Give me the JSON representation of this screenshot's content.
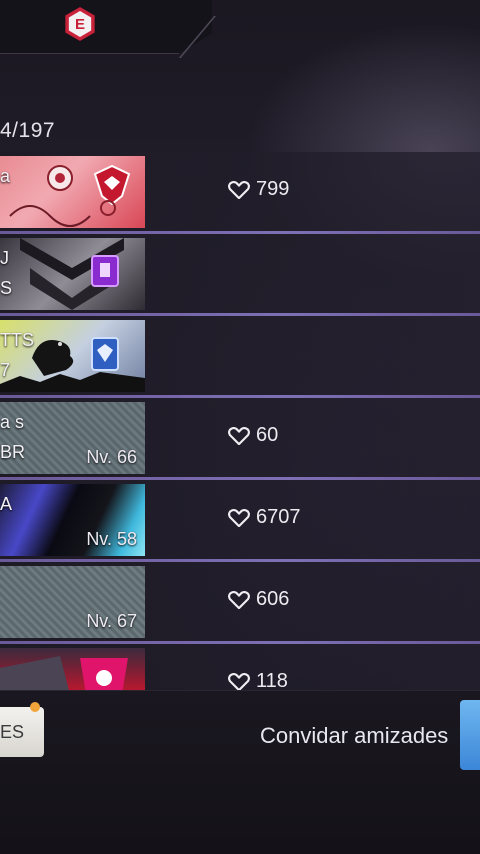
{
  "header": {
    "badge_letter": "E",
    "counter": "4/197"
  },
  "friends": [
    {
      "card_line1": "a",
      "card_line2": "",
      "level": "",
      "likes": "799"
    },
    {
      "card_line1": "J",
      "card_line2": "S",
      "level": "",
      "likes": ""
    },
    {
      "card_line1": "TTS",
      "card_line2": "7",
      "level": "",
      "likes": ""
    },
    {
      "card_line1": "a s",
      "card_line2": "BR",
      "level": "Nv. 66",
      "likes": "60"
    },
    {
      "card_line1": "A",
      "card_line2": "",
      "level": "Nv. 58",
      "likes": "6707"
    },
    {
      "card_line1": "",
      "card_line2": "",
      "level": "Nv. 67",
      "likes": "606"
    },
    {
      "card_line1": "",
      "card_line2": "",
      "level": "",
      "likes": "118"
    }
  ],
  "footer": {
    "left_button_label": "ES",
    "invite_label": "Convidar amizades"
  },
  "colors": {
    "accent_separator": "#7f6fb5",
    "badge_red": "#c9213a",
    "invite_blue": "#3c86d8"
  }
}
